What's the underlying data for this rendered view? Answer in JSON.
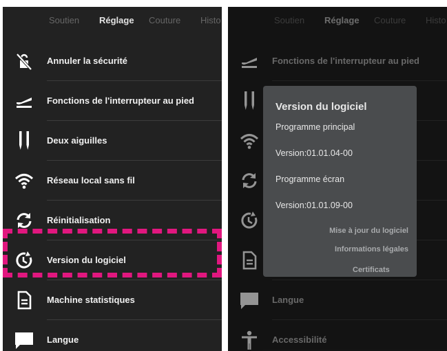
{
  "tabs": [
    "Soutien",
    "Réglage",
    "Couture",
    "Historique"
  ],
  "tabs_visible_text": [
    "Soutien",
    "Réglage",
    "Couture",
    "Histo"
  ],
  "left_menu": [
    {
      "label": "Annuler la sécurité",
      "icon": "unlock-icon"
    },
    {
      "label": "Fonctions de l'interrupteur au pied",
      "icon": "foot-pedal-icon"
    },
    {
      "label": "Deux aiguilles",
      "icon": "twin-needle-icon"
    },
    {
      "label": "Réseau local sans fil",
      "icon": "wifi-icon"
    },
    {
      "label": "Réinitialisation",
      "icon": "reset-icon"
    },
    {
      "label": "Version du logiciel",
      "icon": "software-version-icon"
    },
    {
      "label": "Machine statistiques",
      "icon": "document-icon"
    },
    {
      "label": "Langue",
      "icon": "speech-bubble-icon"
    }
  ],
  "right_menu": [
    {
      "label": "Fonctions de l'interrupteur au pied",
      "icon": "foot-pedal-icon"
    },
    {
      "label": "",
      "icon": "twin-needle-icon"
    },
    {
      "label": "",
      "icon": "wifi-icon"
    },
    {
      "label": "",
      "icon": "reset-icon"
    },
    {
      "label": "",
      "icon": "software-version-icon"
    },
    {
      "label": "",
      "icon": "document-icon"
    },
    {
      "label": "Langue",
      "icon": "speech-bubble-icon"
    },
    {
      "label": "Accessibilité",
      "icon": "accessibility-icon"
    }
  ],
  "dialog": {
    "title": "Version du logiciel",
    "main_program_label": "Programme principal",
    "main_program_version": "Version:01.01.04-00",
    "screen_program_label": "Programme écran",
    "screen_program_version": "Version:01.01.09-00",
    "links": [
      "Mise à jour du logiciel",
      "Informations légales",
      "Certificats"
    ]
  },
  "colors": {
    "background": "#222222",
    "highlight": "#e1177f",
    "dialog_bg": "#4a4c4e"
  }
}
